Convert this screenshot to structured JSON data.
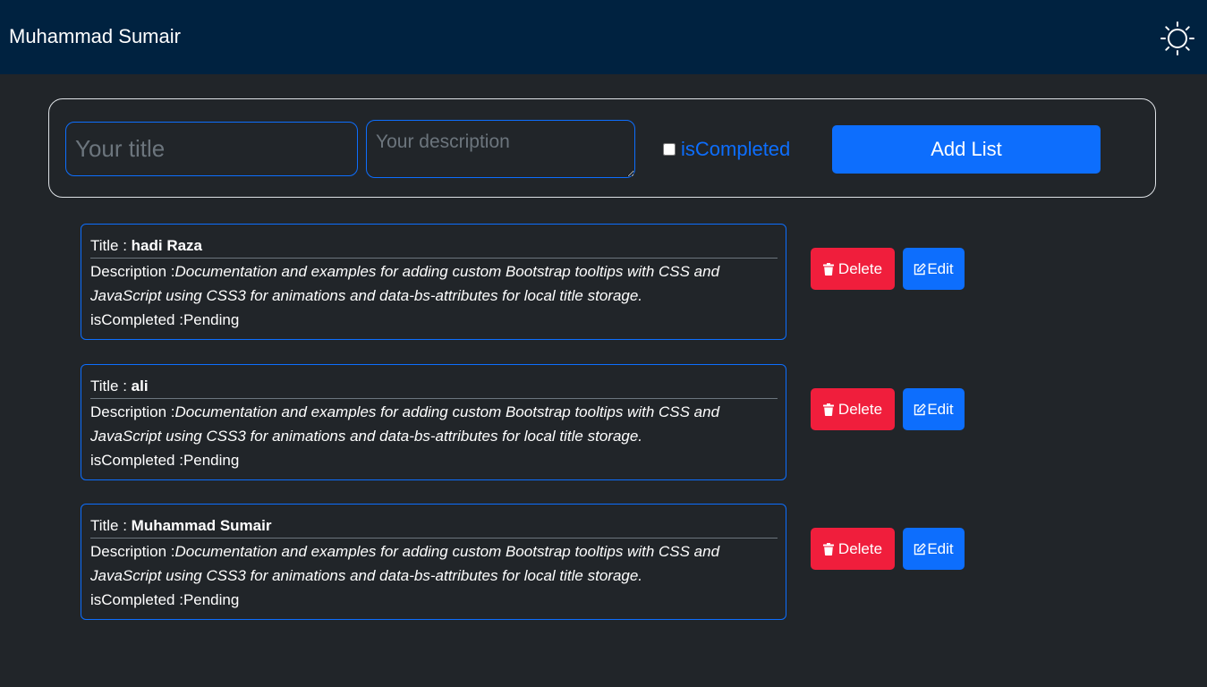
{
  "navbar": {
    "brand": "Muhammad Sumair",
    "theme_icon": "sun-icon"
  },
  "form": {
    "title_placeholder": "Your title",
    "title_value": "",
    "description_placeholder": "Your description",
    "description_value": "",
    "completed_label": "isCompleted",
    "completed_checked": false,
    "add_button_label": "Add List"
  },
  "tasks": [
    {
      "title_label": "Title : ",
      "title": "hadi Raza",
      "description_label": "Description :",
      "description": "Documentation and examples for adding custom Bootstrap tooltips with CSS and JavaScript using CSS3 for animations and data-bs-attributes for local title storage.",
      "status_label": "isCompleted :",
      "status": "Pending",
      "delete_label": "Delete",
      "edit_label": "Edit"
    },
    {
      "title_label": "Title : ",
      "title": "ali",
      "description_label": "Description :",
      "description": "Documentation and examples for adding custom Bootstrap tooltips with CSS and JavaScript using CSS3 for animations and data-bs-attributes for local title storage.",
      "status_label": "isCompleted :",
      "status": "Pending",
      "delete_label": "Delete",
      "edit_label": "Edit"
    },
    {
      "title_label": "Title : ",
      "title": "Muhammad Sumair",
      "description_label": "Description :",
      "description": "Documentation and examples for adding custom Bootstrap tooltips with CSS and JavaScript using CSS3 for animations and data-bs-attributes for local title storage.",
      "status_label": "isCompleted :",
      "status": "Pending",
      "delete_label": "Delete",
      "edit_label": "Edit"
    }
  ],
  "colors": {
    "navbar_bg": "#002240",
    "page_bg": "#212529",
    "primary": "#0d6efd",
    "danger": "#f01e3c"
  },
  "icons": {
    "delete": "trash-icon",
    "edit": "pencil-square-icon"
  }
}
